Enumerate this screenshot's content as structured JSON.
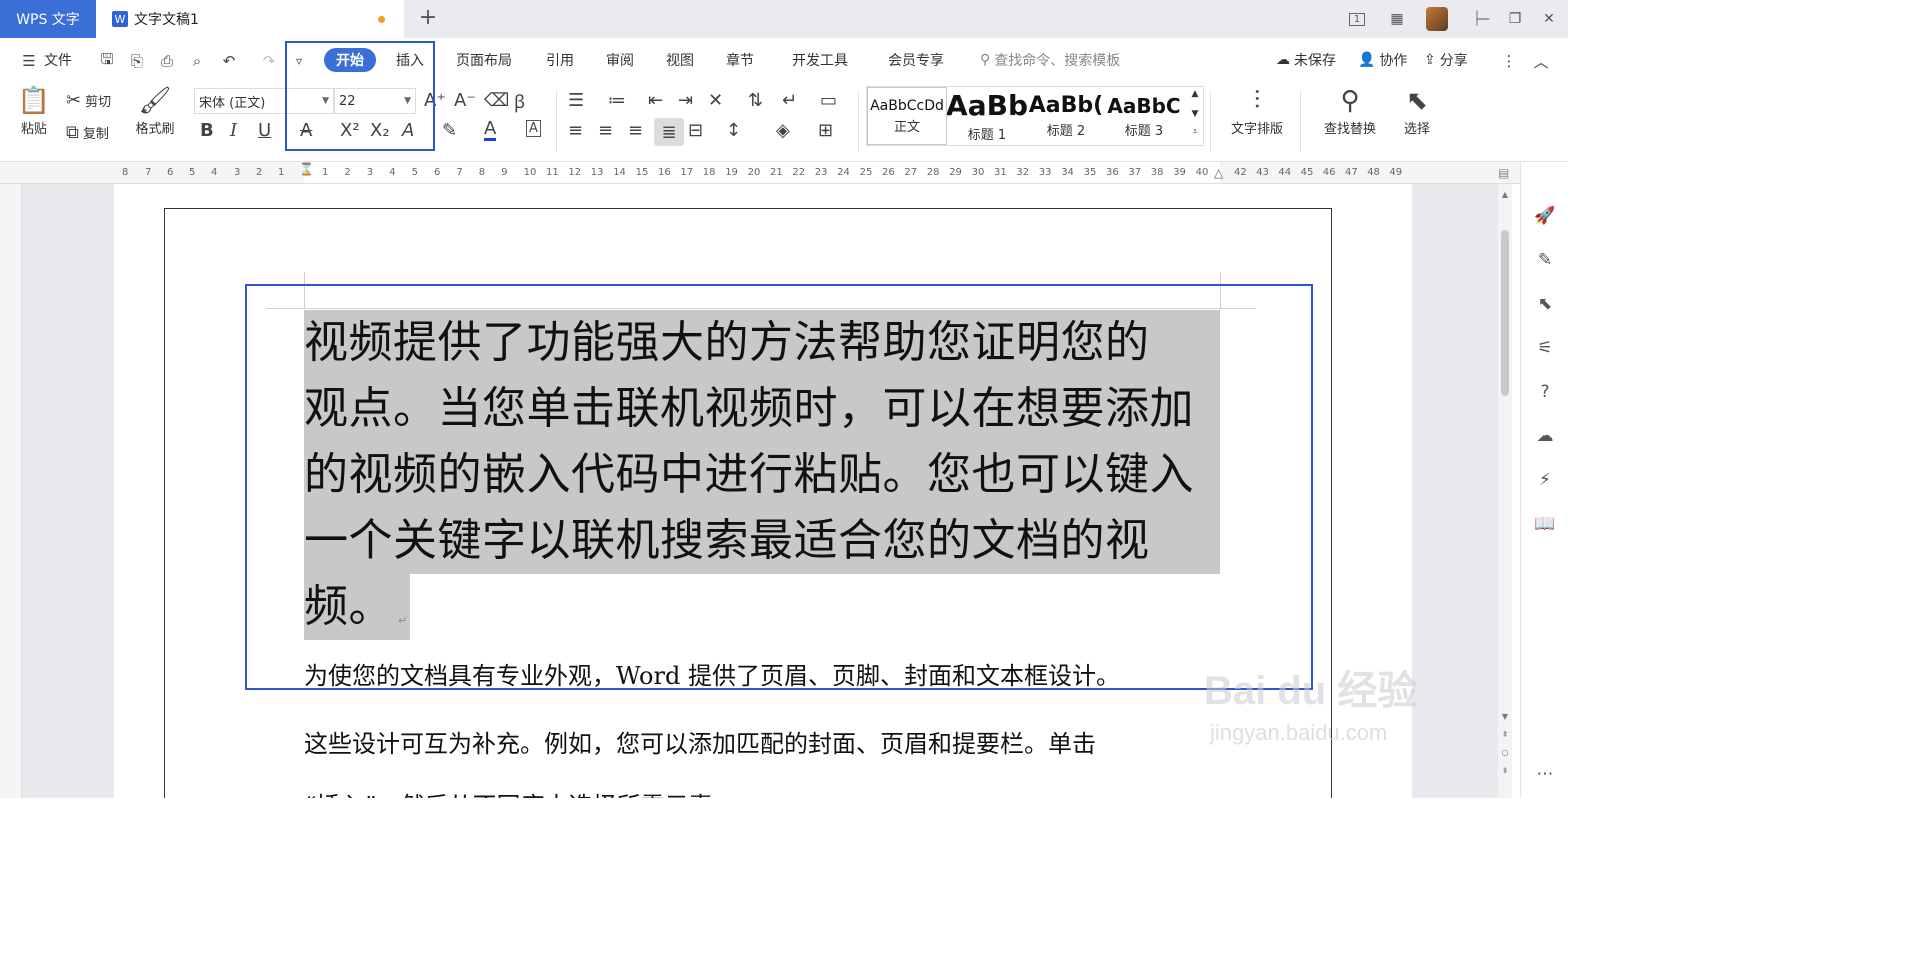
{
  "titlebar": {
    "app_tab": "WPS 文字",
    "doc_tab": "文字文稿1",
    "new_tab": "+",
    "page_indicator": "1"
  },
  "menubar": {
    "file": "文件",
    "tabs": [
      "开始",
      "插入",
      "页面布局",
      "引用",
      "审阅",
      "视图",
      "章节",
      "开发工具",
      "会员专享"
    ],
    "search_placeholder": "查找命令、搜索模板",
    "unsaved": "未保存",
    "collaborate": "协作",
    "share": "分享"
  },
  "ribbon": {
    "paste": "粘贴",
    "cut": "剪切",
    "copy": "复制",
    "format_painter": "格式刷",
    "font_name": "宋体 (正文)",
    "font_size": "22",
    "styles": [
      {
        "sample": "AaBbCcDd",
        "label": "正文"
      },
      {
        "sample": "AaBb",
        "label": "标题 1"
      },
      {
        "sample": "AaBb(",
        "label": "标题 2"
      },
      {
        "sample": "AaBbC",
        "label": "标题 3"
      }
    ],
    "text_layout": "文字排版",
    "find_replace": "查找替换",
    "select": "选择",
    "font_color": "#1f3fd6",
    "highlight_color": "#3a6fd8"
  },
  "ruler": {
    "left_numbers": [
      "8",
      "7",
      "6",
      "5",
      "4",
      "3",
      "2",
      "1"
    ],
    "right_numbers": [
      "1",
      "2",
      "3",
      "4",
      "5",
      "6",
      "7",
      "8",
      "9",
      "10",
      "11",
      "12",
      "13",
      "14",
      "15",
      "16",
      "17",
      "18",
      "19",
      "20",
      "21",
      "22",
      "23",
      "24",
      "25",
      "26",
      "27",
      "28",
      "29",
      "30",
      "31",
      "32",
      "33",
      "34",
      "35",
      "36",
      "37",
      "38",
      "39",
      "40"
    ],
    "tail_numbers": [
      "42",
      "43",
      "44",
      "45",
      "46",
      "47",
      "48",
      "49"
    ]
  },
  "document": {
    "selected_lines": [
      "视频提供了功能强大的方法帮助您证明您的",
      "观点。当您单击联机视频时，可以在想要添加",
      "的视频的嵌入代码中进行粘贴。您也可以键入",
      "一个关键字以联机搜索最适合您的文档的视",
      "频。"
    ],
    "body_lines": [
      "为使您的文档具有专业外观，Word 提供了页眉、页脚、封面和文本框设计。",
      "这些设计可互为补充。例如，您可以添加匹配的封面、页眉和提要栏。单击",
      "“插入”，然后从不同库中选择所需元素。"
    ]
  },
  "watermark": {
    "logo": "Bai du 经验",
    "url": "jingyan.baidu.com"
  }
}
